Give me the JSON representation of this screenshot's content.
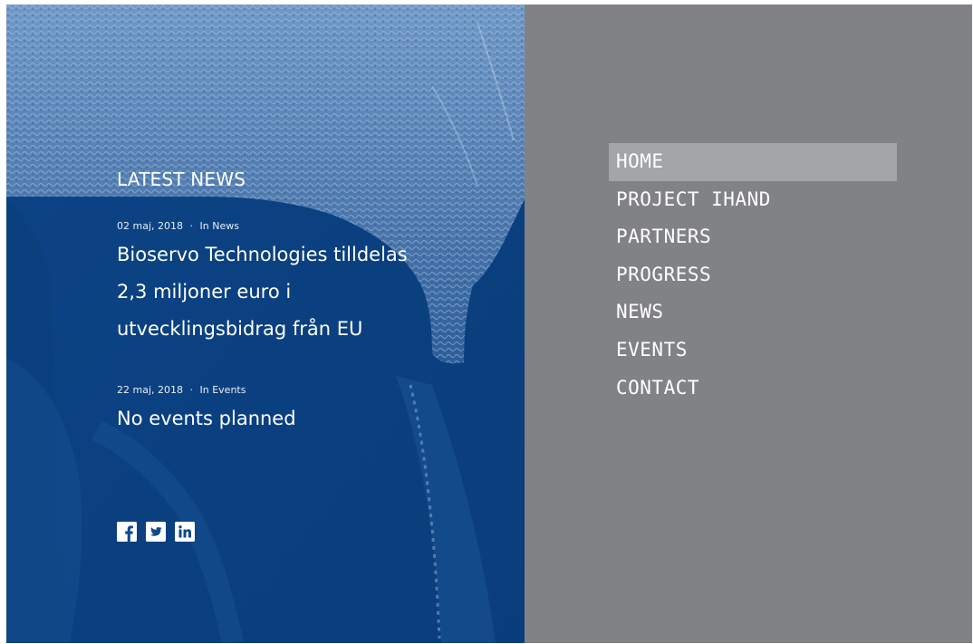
{
  "latest_news": {
    "title": "LATEST NEWS",
    "news": {
      "date": "02 maj, 2018",
      "separator": "·",
      "category": "In News",
      "headline": "Bioservo Technologies tilldelas 2,3 miljoner euro i utvecklingsbidrag från EU"
    },
    "event": {
      "date": "22 maj, 2018",
      "separator": "·",
      "category": "In Events",
      "headline": "No events planned"
    }
  },
  "social": {
    "icons": [
      "facebook-icon",
      "twitter-icon",
      "linkedin-icon"
    ]
  },
  "nav": {
    "items": [
      {
        "label": "HOME",
        "active": true
      },
      {
        "label": "PROJECT IHAND",
        "active": false
      },
      {
        "label": "PARTNERS",
        "active": false
      },
      {
        "label": "PROGRESS",
        "active": false
      },
      {
        "label": "NEWS",
        "active": false
      },
      {
        "label": "EVENTS",
        "active": false
      },
      {
        "label": "CONTACT",
        "active": false
      }
    ]
  },
  "colors": {
    "left_panel": "#0d4a8a",
    "right_panel": "#818285",
    "active_nav_bg": "#a4a5a7",
    "text": "#ffffff"
  }
}
